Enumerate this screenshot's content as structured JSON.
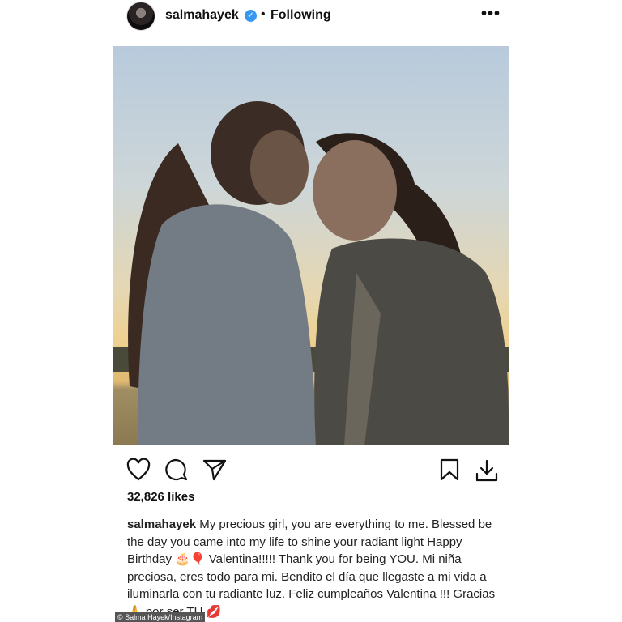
{
  "header": {
    "username": "salmahayek",
    "verified_icon": "verified-badge-icon",
    "separator": "•",
    "following_label": "Following",
    "more_label": "•••"
  },
  "photo": {
    "alt_subject": "two people touching foreheads at sunset"
  },
  "actions": {
    "like_icon": "heart-icon",
    "comment_icon": "comment-icon",
    "share_icon": "send-icon",
    "save_icon": "bookmark-icon",
    "download_icon": "download-icon"
  },
  "likes_text": "32,826 likes",
  "caption": {
    "username": "salmahayek",
    "text": "My precious girl, you are everything to me. Blessed be the day you came into my life to shine your radiant light Happy Birthday 🎂🎈 Valentina!!!!! Thank you for being YOU. Mi niña preciosa, eres todo para mi. Bendito el día que llegaste a mi vida a iluminarla con tu radiante luz. Feliz cumpleaños Valentina !!! Gracias 🙏 por ser TU 💋"
  },
  "credit": "© Salma Hayek/Instagram"
}
